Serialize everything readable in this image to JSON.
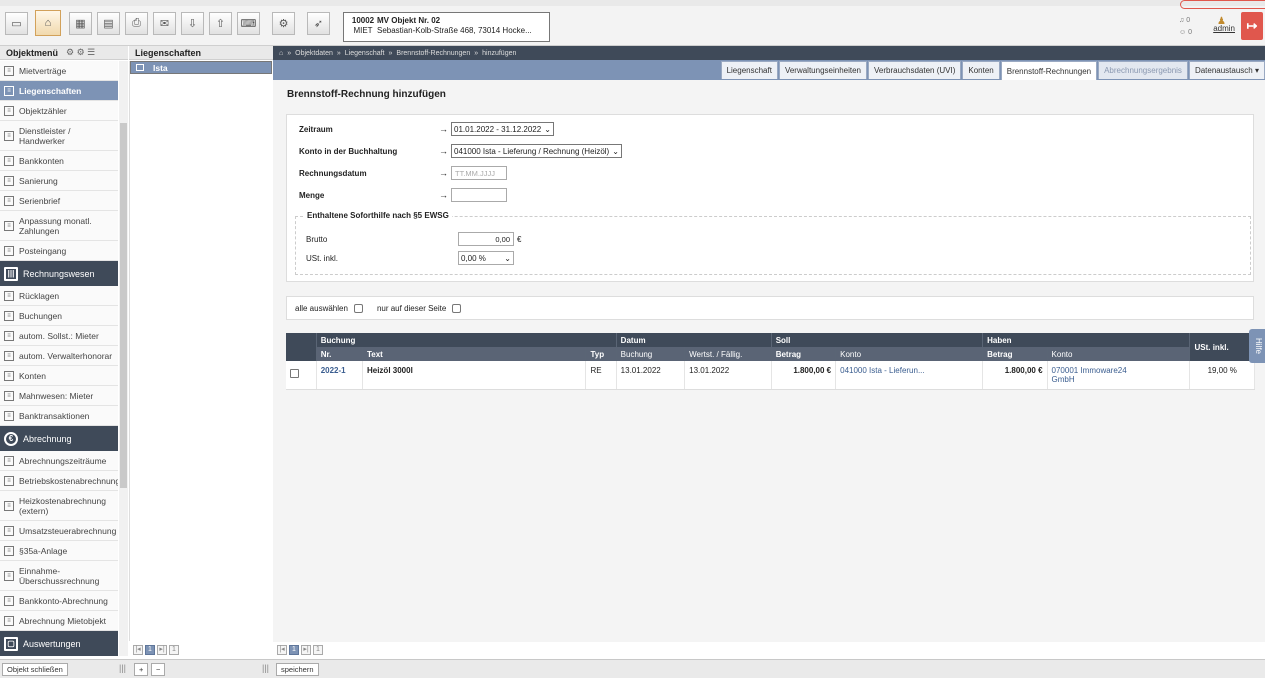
{
  "object": {
    "nr": "10002",
    "name": "MV Objekt Nr. 02",
    "type": "MIET",
    "address": "Sebastian-Kolb-Straße 468, 73014 Hocke..."
  },
  "user": {
    "name": "admin",
    "notif1": "0",
    "notif2": "0"
  },
  "sidebar": {
    "header": "Objektmenü",
    "items": [
      {
        "label": "Mietverträge"
      },
      {
        "label": "Liegenschaften"
      },
      {
        "label": "Objektzähler"
      },
      {
        "label": "Dienstleister / Handwerker"
      },
      {
        "label": "Bankkonten"
      },
      {
        "label": "Sanierung"
      },
      {
        "label": "Serienbrief"
      },
      {
        "label": "Anpassung monatl. Zahlungen"
      },
      {
        "label": "Posteingang"
      }
    ],
    "group_rechnungswesen": "Rechnungswesen",
    "items2": [
      {
        "label": "Rücklagen"
      },
      {
        "label": "Buchungen"
      },
      {
        "label": "autom. Sollst.: Mieter"
      },
      {
        "label": "autom. Verwalterhonorar"
      },
      {
        "label": "Konten"
      },
      {
        "label": "Mahnwesen: Mieter"
      },
      {
        "label": "Banktransaktionen"
      }
    ],
    "group_abrechnung": "Abrechnung",
    "items3": [
      {
        "label": "Abrechnungszeiträume"
      },
      {
        "label": "Betriebskostenabrechnung"
      },
      {
        "label": "Heizkostenabrechnung (extern)"
      },
      {
        "label": "Umsatzsteuerabrechnung"
      },
      {
        "label": "§35a-Anlage"
      },
      {
        "label": "Einnahme-Überschussrechnung"
      },
      {
        "label": "Bankkonto-Abrechnung"
      },
      {
        "label": "Abrechnung Mietobjekt"
      }
    ],
    "group_auswertungen": "Auswertungen"
  },
  "tree": {
    "header": "Liegenschaften",
    "selected": "Ista"
  },
  "breadcrumb": [
    "Objektdaten",
    "Liegenschaft",
    "Brennstoff-Rechnungen",
    "hinzufügen"
  ],
  "tabs": [
    "Liegenschaft",
    "Verwaltungseinheiten",
    "Verbrauchsdaten (UVI)",
    "Konten",
    "Brennstoff-Rechnungen",
    "Abrechnungsergebnis",
    "Datenaustausch ▾"
  ],
  "page_title": "Brennstoff-Rechnung hinzufügen",
  "form": {
    "zeitraum_label": "Zeitraum",
    "zeitraum_value": "01.01.2022 - 31.12.2022",
    "konto_label": "Konto in der Buchhaltung",
    "konto_value": "041000 Ista - Lieferung / Rechnung (Heizöl)",
    "datum_label": "Rechnungsdatum",
    "datum_placeholder": "TT.MM.JJJJ",
    "menge_label": "Menge",
    "fieldset_legend": "Enthaltene Soforthilfe nach §5 EWSG",
    "brutto_label": "Brutto",
    "brutto_value": "0,00",
    "currency": "€",
    "ust_label": "USt. inkl.",
    "ust_value": "0,00 %"
  },
  "selection": {
    "all_label": "alle auswählen",
    "page_label": "nur auf dieser Seite"
  },
  "table": {
    "groups": [
      "Buchung",
      "Datum",
      "Soll",
      "Haben",
      "USt. inkl."
    ],
    "cols": [
      "Nr.",
      "Text",
      "Typ",
      "Buchung",
      "Wertst. / Fällig.",
      "Betrag",
      "Konto",
      "Betrag",
      "Konto"
    ],
    "row": {
      "nr": "2022-1",
      "text": "Heizöl 3000l",
      "typ": "RE",
      "buchung": "13.01.2022",
      "wertst": "13.01.2022",
      "soll_betrag": "1.800,00 €",
      "soll_konto": "041000 Ista - Lieferun...",
      "haben_betrag": "1.800,00 €",
      "haben_konto": "070001 Immoware24 GmbH",
      "ust": "19,00 %"
    }
  },
  "pager": {
    "page": "1",
    "total": "1"
  },
  "bottom": {
    "close": "Objekt schließen",
    "plus": "+",
    "minus": "−",
    "save": "speichern"
  },
  "help": "Hilfe"
}
